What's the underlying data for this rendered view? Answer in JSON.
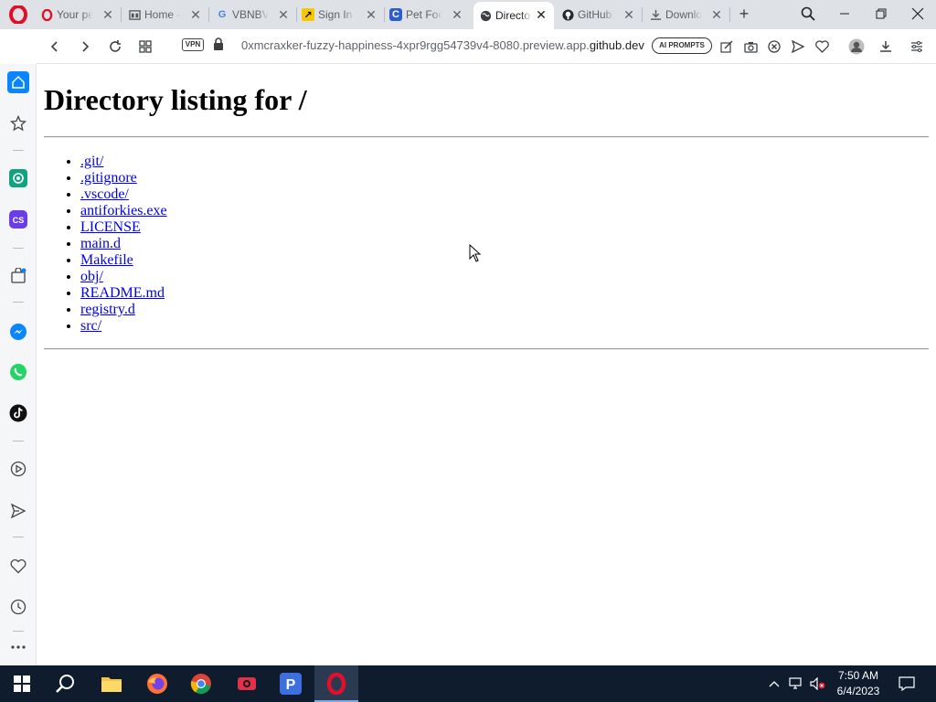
{
  "browser": {
    "tabs": [
      {
        "title": "Your pe",
        "icon": "opera-icon"
      },
      {
        "title": "Home -",
        "icon": "home-page-icon"
      },
      {
        "title": "VBNBV",
        "icon": "google-icon"
      },
      {
        "title": "Sign In",
        "icon": "arrow-app-icon"
      },
      {
        "title": "Pet Foo",
        "icon": "c-app-icon"
      },
      {
        "title": "Directo",
        "icon": "globe-icon",
        "active": true
      },
      {
        "title": "GitHub",
        "icon": "github-icon"
      },
      {
        "title": "Downlo",
        "icon": "download-icon"
      }
    ],
    "vpn_label": "VPN",
    "url_prefix": "0xmcraxker-fuzzy-happiness-4xpr9rgg54739v4-8080.preview.app.",
    "url_domain": "github.dev",
    "ai_prompts_label": "AI PROMPTS"
  },
  "page": {
    "heading": "Directory listing for /",
    "files": [
      ".git/",
      ".gitignore",
      ".vscode/",
      "antiforkies.exe",
      "LICENSE",
      "main.d",
      "Makefile",
      "obj/",
      "README.md",
      "registry.d",
      "src/"
    ]
  },
  "taskbar": {
    "time": "7:50 AM",
    "date": "6/4/2023"
  },
  "colors": {
    "link": "#0000ee",
    "opera_red": "#e0102a",
    "taskbar": "#0e1c2e"
  }
}
